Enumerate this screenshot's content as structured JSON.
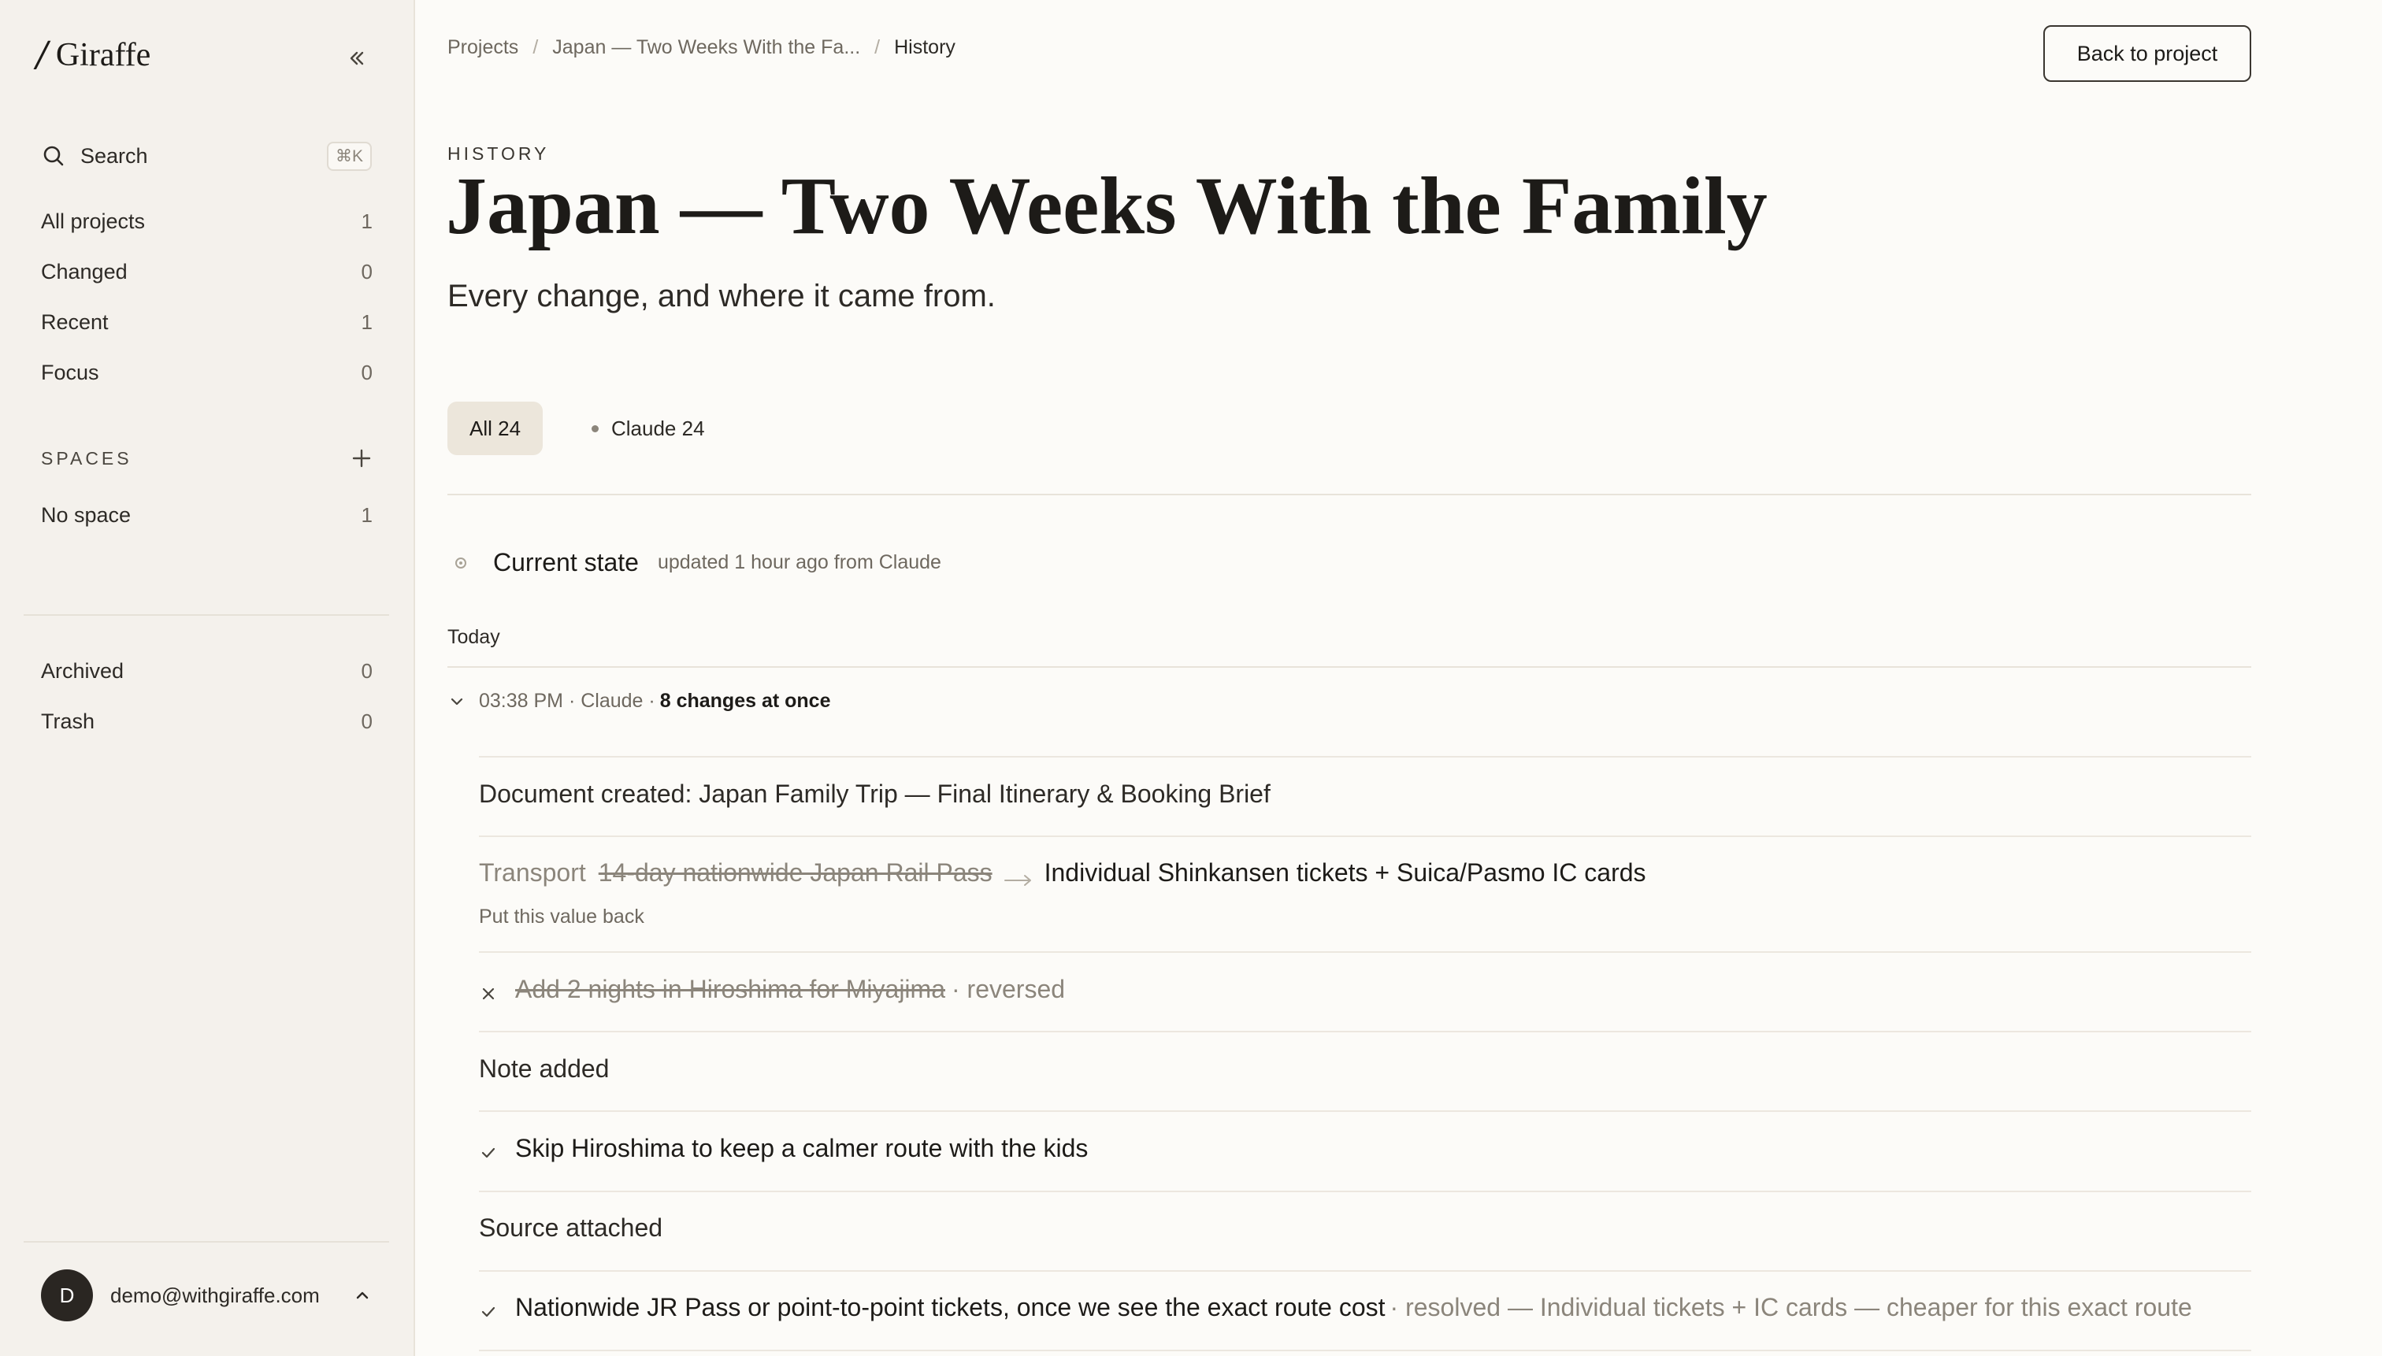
{
  "app": {
    "logo_mark": "/",
    "logo_text": "Giraffe"
  },
  "sidebar": {
    "search_label": "Search",
    "search_shortcut": "⌘K",
    "nav": [
      {
        "label": "All projects",
        "count": "1"
      },
      {
        "label": "Changed",
        "count": "0"
      },
      {
        "label": "Recent",
        "count": "1"
      },
      {
        "label": "Focus",
        "count": "0"
      }
    ],
    "spaces_heading": "SPACES",
    "spaces": [
      {
        "label": "No space",
        "count": "1"
      }
    ],
    "bottom": [
      {
        "label": "Archived",
        "count": "0"
      },
      {
        "label": "Trash",
        "count": "0"
      }
    ],
    "user": {
      "initial": "D",
      "email": "demo@withgiraffe.com"
    }
  },
  "breadcrumb": {
    "root": "Projects",
    "project": "Japan — Two Weeks With the Fa...",
    "current": "History",
    "sep": "/"
  },
  "header": {
    "back_label": "Back to project",
    "eyebrow": "HISTORY",
    "title": "Japan — Two Weeks With the Family",
    "subtitle": "Every change, and where it came from."
  },
  "filters": {
    "all": "All 24",
    "claude": "Claude 24"
  },
  "current_state": {
    "title": "Current state",
    "meta": "updated 1 hour ago from Claude"
  },
  "timeline": {
    "day": "Today",
    "group": {
      "meta": "03:38 PM · Claude ·",
      "summary": "8 changes at once"
    },
    "changes": {
      "doc_created": "Document created: Japan Family Trip — Final Itinerary & Booking Brief",
      "transport_field": "Transport",
      "transport_old": "14-day nationwide Japan Rail Pass",
      "transport_new": "Individual Shinkansen tickets + Suica/Pasmo IC cards",
      "transport_undo": "Put this value back",
      "reversed_item": "Add 2 nights in Hiroshima for Miyajima",
      "reversed_status": "· reversed",
      "note_added": "Note added",
      "decision_1": "Skip Hiroshima to keep a calmer route with the kids",
      "source_attached": "Source attached",
      "decision_2": "Nationwide JR Pass or point-to-point tickets, once we see the exact route cost",
      "decision_2_resolution": "· resolved — Individual tickets + IC cards — cheaper for this exact route"
    }
  },
  "colors": {
    "accent": "#1d1b18",
    "sidebar_bg": "#f4f1ec",
    "page_bg": "#fcfbf8",
    "muted": "#8b857b"
  }
}
